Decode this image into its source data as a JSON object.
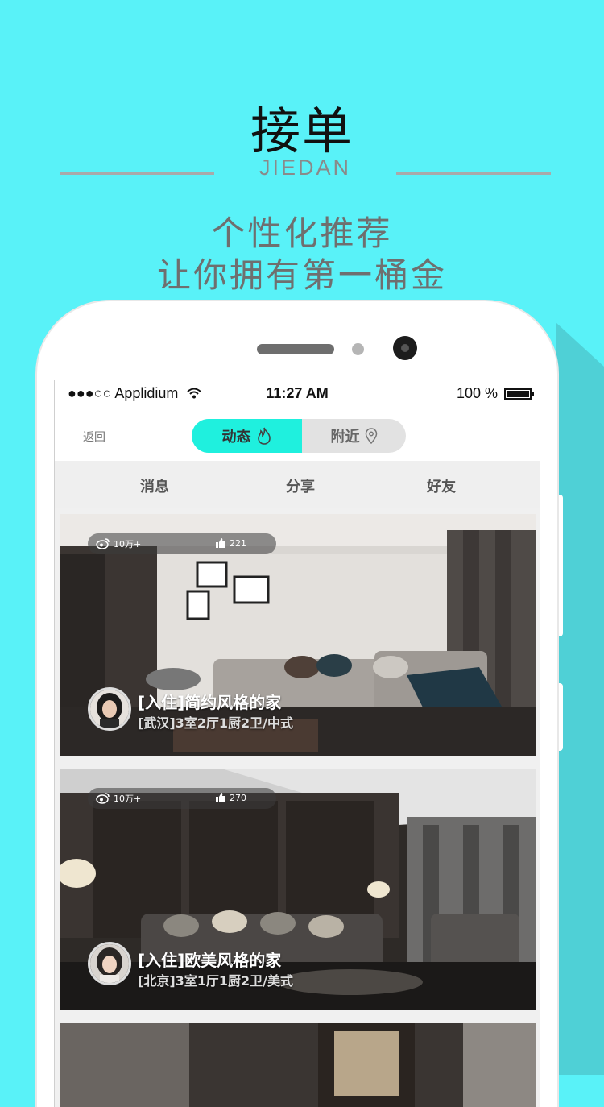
{
  "header": {
    "title": "接单",
    "subtitle": "JIEDAN",
    "tagline_1": "个性化推荐",
    "tagline_2": "让你拥有第一桶金"
  },
  "status_bar": {
    "carrier": "●●●○○ Applidium",
    "time": "11:27 AM",
    "battery": "100 %"
  },
  "nav": {
    "back_label": "返回",
    "segments": [
      "动态",
      "附近"
    ]
  },
  "tabs": [
    "消息",
    "分享",
    "好友"
  ],
  "feed": [
    {
      "views": "10万+",
      "likes": "221",
      "title": "[入住]简约风格的家",
      "meta": "[武汉]3室2厅1厨2卫/中式"
    },
    {
      "views": "10万+",
      "likes": "270",
      "title": "[入住]欧美风格的家",
      "meta": "[北京]3室1厅1厨2卫/美式"
    }
  ],
  "colors": {
    "background": "#59f2f8",
    "accent": "#1ff0de"
  }
}
